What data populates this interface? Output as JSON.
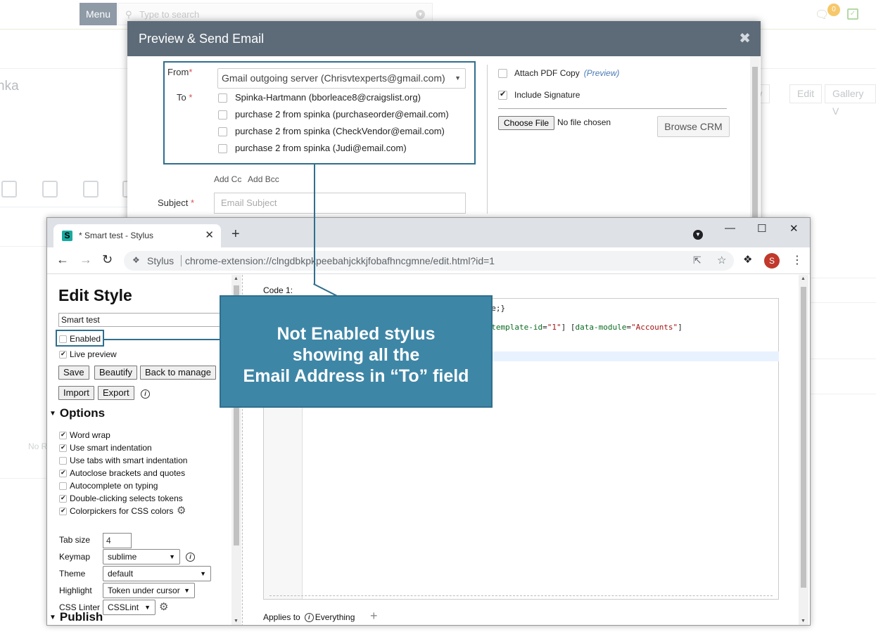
{
  "crm": {
    "menu_label": "Menu",
    "search_placeholder": "Type to search",
    "notification_count": "0",
    "page_title_partial": "nka",
    "buttons": [
      "w",
      "Edit",
      "Gallery V"
    ],
    "no_records_partial": "No R"
  },
  "email_modal": {
    "title": "Preview & Send Email",
    "from_label": "From",
    "from_value": "Gmail outgoing server (Chrisvtexperts@gmail.com)",
    "to_label": "To",
    "recipients": [
      {
        "label": "Spinka-Hartmann (bborleace8@craigslist.org)",
        "checked": false
      },
      {
        "label": "purchase 2 from spinka (purchaseorder@email.com)",
        "checked": false
      },
      {
        "label": "purchase 2 from spinka (CheckVendor@email.com)",
        "checked": false
      },
      {
        "label": "purchase 2 from spinka (Judi@email.com)",
        "checked": false
      }
    ],
    "add_cc": "Add Cc",
    "add_bcc": "Add Bcc",
    "subject_label": "Subject",
    "subject_placeholder": "Email Subject",
    "attach_pdf_label": "Attach PDF Copy",
    "preview_link": "(Preview)",
    "include_signature_label": "Include Signature",
    "choose_file_label": "Choose File",
    "no_file_text": "No file chosen",
    "browse_crm_label": "Browse CRM"
  },
  "browser": {
    "tab_title": "* Smart test - Stylus",
    "favicon_letter": "S",
    "omnibox_name": "Stylus",
    "url": "chrome-extension://clngdbkpkpeebahjckkjfobafhncgmne/edit.html?id=1",
    "avatar_letter": "S"
  },
  "stylus": {
    "heading": "Edit Style",
    "style_name": "Smart test",
    "enabled_label": "Enabled",
    "live_preview_label": "Live preview",
    "buttons": {
      "save": "Save",
      "beautify": "Beautify",
      "back_to_manage": "Back to manage",
      "import": "Import",
      "export": "Export"
    },
    "options_heading": "Options",
    "options": [
      {
        "label": "Word wrap",
        "checked": true
      },
      {
        "label": "Use smart indentation",
        "checked": true
      },
      {
        "label": "Use tabs with smart indentation",
        "checked": false
      },
      {
        "label": "Autoclose brackets and quotes",
        "checked": true
      },
      {
        "label": "Autocomplete on typing",
        "checked": false
      },
      {
        "label": "Double-clicking selects tokens",
        "checked": true
      },
      {
        "label": "Colorpickers for CSS colors",
        "checked": true
      }
    ],
    "tab_size_label": "Tab size",
    "tab_size_value": "4",
    "keymap_label": "Keymap",
    "keymap_value": "sublime",
    "theme_label": "Theme",
    "theme_value": "default",
    "highlight_label": "Highlight",
    "highlight_value": "Token under cursor",
    "css_linter_label": "CSS Linter",
    "css_linter_value": "CSSLint",
    "publish_heading": "Publish",
    "code_label": "Code 1:",
    "code_line1": "one;}",
    "code_line2_a": "d-template-id",
    "code_line2_b": "=",
    "code_line2_c": "\"1\"",
    "code_line2_d": "] [",
    "code_line2_e": "data-module",
    "code_line2_f": "=",
    "code_line2_g": "\"Accounts\"",
    "code_line2_h": "]",
    "applies_to_label": "Applies to",
    "applies_to_value": "Everything"
  },
  "annotation": {
    "line1": "Not Enabled stylus",
    "line2": "showing all the",
    "line3": "Email Address in “To” field"
  },
  "colors": {
    "modal_header": "#5d6b78",
    "callout_fill": "#3e86a6",
    "callout_border": "#2f6f8e",
    "required_star": "#d9534f"
  }
}
